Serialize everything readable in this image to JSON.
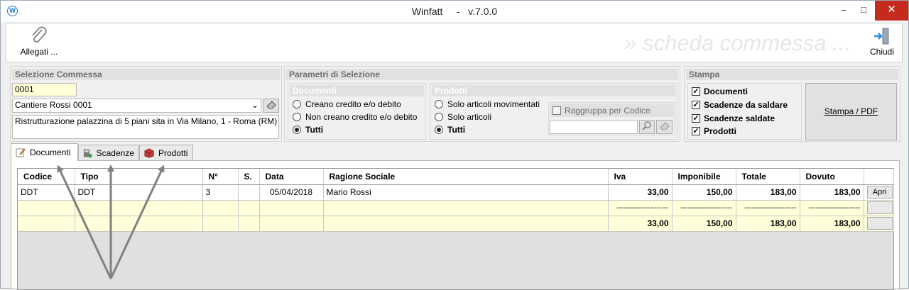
{
  "window": {
    "title": "Winfatt",
    "version": "v.7.0.0",
    "minimize": "–",
    "maximize": "□",
    "close": "✕"
  },
  "toolbar": {
    "attach_label": "Allegati ...",
    "close_label": "Chiudi",
    "watermark": "» scheda commessa ..."
  },
  "selezione": {
    "header": "Selezione Commessa",
    "code": "0001",
    "name": "Cantiere Rossi 0001",
    "description": "Ristrutturazione palazzina di 5 piani sita in Via Milano, 1 - Roma (RM)"
  },
  "parametri": {
    "header": "Parametri di Selezione",
    "documenti": {
      "header": "Documenti",
      "options": [
        "Creano credito e/o debito",
        "Non creano credito e/o debito",
        "Tutti"
      ],
      "selected": 2
    },
    "prodotti": {
      "header": "Prodotti",
      "options": [
        "Solo articoli movimentati",
        "Solo articoli",
        "Tutti"
      ],
      "selected": 2,
      "group_label": "Raggruppa per Codice",
      "group_checked": false,
      "search_value": ""
    }
  },
  "stampa": {
    "header": "Stampa",
    "checks": [
      {
        "label": "Documenti",
        "checked": true
      },
      {
        "label": "Scadenze da saldare",
        "checked": true
      },
      {
        "label": "Scadenze saldate",
        "checked": true
      },
      {
        "label": "Prodotti",
        "checked": true
      }
    ],
    "button_label": "Stampa / PDF"
  },
  "tabs": [
    {
      "label": "Documenti",
      "active": true,
      "icon": "edit-icon"
    },
    {
      "label": "Scadenze",
      "active": false,
      "icon": "calculator-icon"
    },
    {
      "label": "Prodotti",
      "active": false,
      "icon": "box-icon"
    }
  ],
  "grid": {
    "columns": [
      "Codice",
      "Tipo",
      "N°",
      "S.",
      "Data",
      "Ragione Sociale",
      "Iva",
      "Imponibile",
      "Totale",
      "Dovuto",
      ""
    ],
    "rows": [
      {
        "codice": "DDT",
        "tipo": "DDT",
        "numero": "3",
        "serie": "",
        "data": "05/04/2018",
        "ragione": "Mario Rossi",
        "iva": "33,00",
        "imponibile": "150,00",
        "totale": "183,00",
        "dovuto": "183,00",
        "action": "Apri"
      },
      {
        "codice": "",
        "tipo": "",
        "numero": "",
        "serie": "",
        "data": "",
        "ragione": "",
        "iva": "----------------------",
        "imponibile": "----------------------",
        "totale": "----------------------",
        "dovuto": "----------------------",
        "action": ""
      },
      {
        "codice": "",
        "tipo": "",
        "numero": "",
        "serie": "",
        "data": "",
        "ragione": "",
        "iva": "33,00",
        "imponibile": "150,00",
        "totale": "183,00",
        "dovuto": "183,00",
        "action": ""
      }
    ]
  },
  "colors": {
    "accent": "#1a6fd1",
    "close_red": "#c42b1c",
    "yellow_field": "#ffffd9",
    "arrow_gray": "#808080"
  }
}
